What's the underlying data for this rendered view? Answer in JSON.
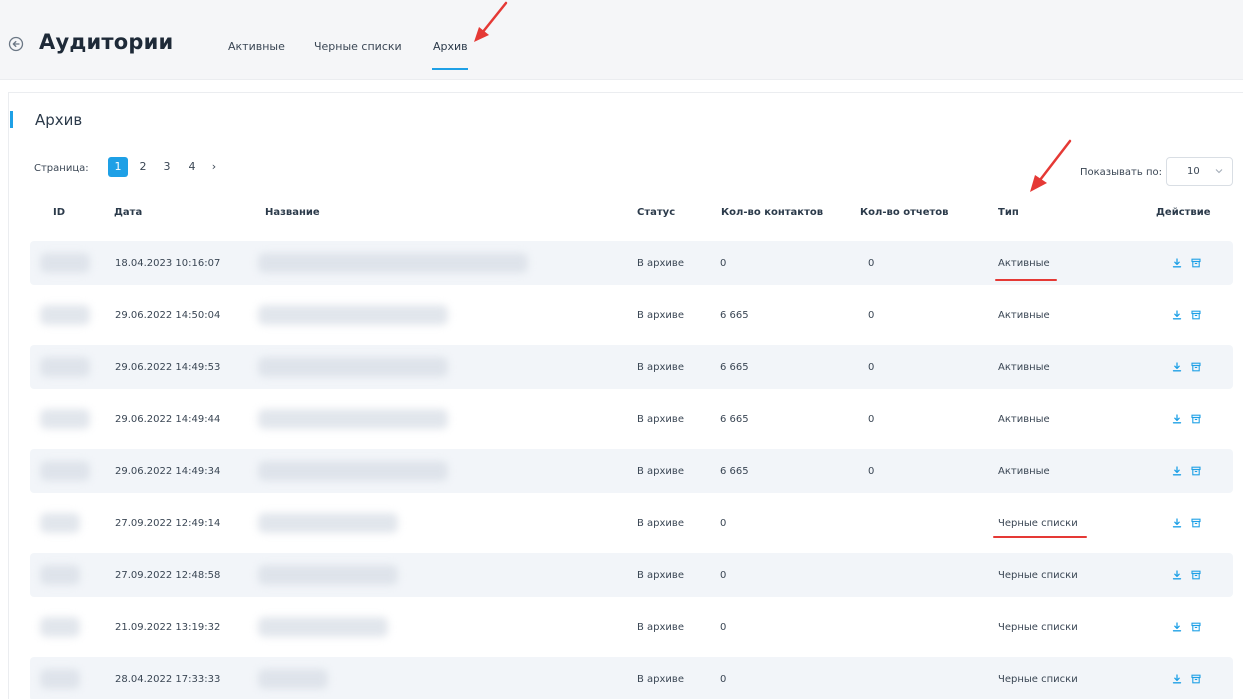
{
  "header": {
    "title": "Аудитории",
    "tabs": [
      {
        "label": "Активные"
      },
      {
        "label": "Черные списки"
      },
      {
        "label": "Архив",
        "active": true
      }
    ]
  },
  "section": {
    "title": "Архив"
  },
  "pagination": {
    "label": "Страница:",
    "pages": [
      "1",
      "2",
      "3",
      "4"
    ],
    "current": "1",
    "next": "›"
  },
  "page_size": {
    "label": "Показывать по:",
    "value": "10"
  },
  "table": {
    "columns": [
      "ID",
      "Дата",
      "Название",
      "Статус",
      "Кол-во контактов",
      "Кол-во отчетов",
      "Тип",
      "Действие"
    ],
    "rows": [
      {
        "date": "18.04.2023 10:16:07",
        "status": "В архиве",
        "contacts": "0",
        "reports": "0",
        "type": "Активные"
      },
      {
        "date": "29.06.2022 14:50:04",
        "status": "В архиве",
        "contacts": "6 665",
        "reports": "0",
        "type": "Активные"
      },
      {
        "date": "29.06.2022 14:49:53",
        "status": "В архиве",
        "contacts": "6 665",
        "reports": "0",
        "type": "Активные"
      },
      {
        "date": "29.06.2022 14:49:44",
        "status": "В архиве",
        "contacts": "6 665",
        "reports": "0",
        "type": "Активные"
      },
      {
        "date": "29.06.2022 14:49:34",
        "status": "В архиве",
        "contacts": "6 665",
        "reports": "0",
        "type": "Активные"
      },
      {
        "date": "27.09.2022 12:49:14",
        "status": "В архиве",
        "contacts": "0",
        "reports": "",
        "type": "Черные списки"
      },
      {
        "date": "27.09.2022 12:48:58",
        "status": "В архиве",
        "contacts": "0",
        "reports": "",
        "type": "Черные списки"
      },
      {
        "date": "21.09.2022 13:19:32",
        "status": "В архиве",
        "contacts": "0",
        "reports": "",
        "type": "Черные списки"
      },
      {
        "date": "28.04.2022 17:33:33",
        "status": "В архиве",
        "contacts": "0",
        "reports": "",
        "type": "Черные списки"
      }
    ]
  },
  "icons": {
    "back": "arrow-left-circle-icon",
    "download": "download-icon",
    "unarchive": "archive-box-icon",
    "chevron": "chevron-down-icon"
  },
  "colors": {
    "accent": "#1ea0e6",
    "annotation": "#e53935",
    "row_shade": "#f2f5f9"
  }
}
